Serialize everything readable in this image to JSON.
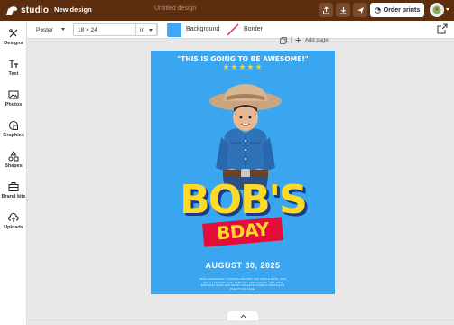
{
  "app": {
    "logo_text": "studio",
    "design_name": "New design",
    "doc_title": "Untitled design",
    "order_label": "Order prints",
    "icons": [
      "share-icon",
      "download-icon",
      "send-icon",
      "order-icon",
      "avatar-icon"
    ]
  },
  "options": {
    "product": "Poster",
    "size": "18 × 24",
    "unit": "in",
    "background_label": "Background",
    "border_label": "Border",
    "background_color": "#3fa9f5"
  },
  "sidebar": {
    "items": [
      {
        "label": "Designs",
        "icon": "designs-icon"
      },
      {
        "label": "Text",
        "icon": "text-icon"
      },
      {
        "label": "Photos",
        "icon": "photos-icon"
      },
      {
        "label": "Graphics",
        "icon": "graphics-icon"
      },
      {
        "label": "Shapes",
        "icon": "shapes-icon"
      },
      {
        "label": "Brand kits",
        "icon": "brand-kits-icon"
      },
      {
        "label": "Uploads",
        "icon": "uploads-icon"
      }
    ]
  },
  "canvas": {
    "add_page": "Add page"
  },
  "poster": {
    "quote": "\"THIS IS GOING TO BE AWESOME!\"",
    "stars": "★★★★★",
    "headline": "BOB'S",
    "subheadline": "BDAY",
    "date": "AUGUST 30, 2025",
    "fine_print": "RIDE HORSEBACK, CAMPING AROUND THE CIRCLE BACK, AND GET A LASSOING FUN, FAMILIES, AND SNACKS, AND 20TH BIRTHDAY BASH HOSTED BY COLLETE COWBOY PANTS AND PLENTY OF CAKE."
  },
  "colors": {
    "topbar": "#5c2d0e",
    "poster_bg": "#3ba6f0",
    "headline": "#ffd928",
    "band": "#e30d3a"
  }
}
